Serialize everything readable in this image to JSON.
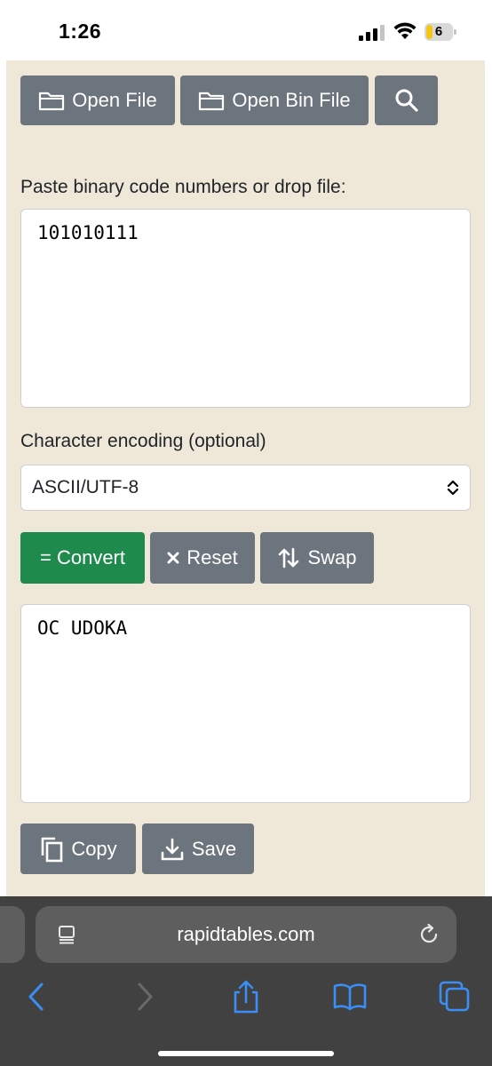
{
  "status_bar": {
    "time": "1:26",
    "battery_level": "6",
    "signal_bars": 3
  },
  "toolbar": {
    "open_file_label": "Open File",
    "open_bin_file_label": "Open Bin File",
    "search_icon": "search-icon"
  },
  "input": {
    "label": "Paste binary code numbers or drop file:",
    "value": "101010111"
  },
  "encoding": {
    "label": "Character encoding (optional)",
    "selected": "ASCII/UTF-8"
  },
  "actions": {
    "convert_label": "= Convert",
    "reset_label": "Reset",
    "swap_label": "Swap"
  },
  "output": {
    "value": "OC UDOKA"
  },
  "output_actions": {
    "copy_label": "Copy",
    "save_label": "Save"
  },
  "browser": {
    "url": "rapidtables.com"
  },
  "colors": {
    "page_background": "#efe8d8",
    "button_gray": "#6c757d",
    "button_green": "#1e8a4c",
    "safari_bar": "#414141",
    "safari_accent": "#3a8ef6"
  }
}
